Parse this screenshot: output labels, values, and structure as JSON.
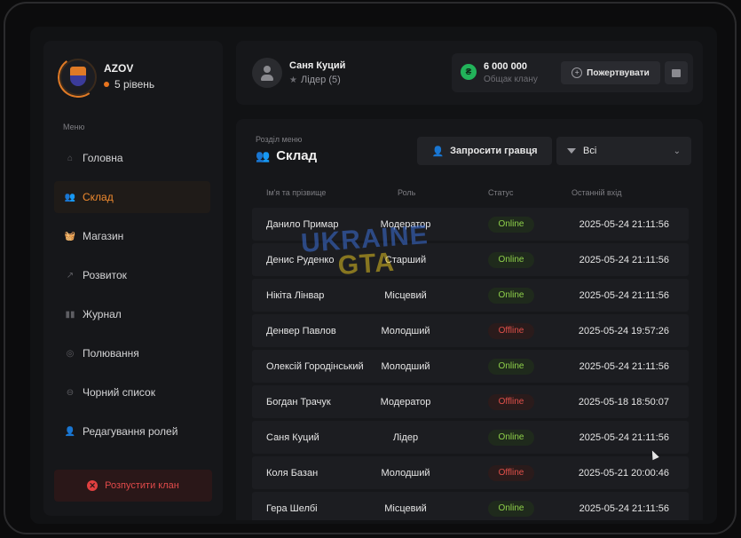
{
  "clan": {
    "name": "AZOV",
    "level": "5 рівень"
  },
  "sidebar": {
    "caption": "Меню",
    "items": [
      {
        "label": "Головна",
        "icon": "home-icon",
        "active": false
      },
      {
        "label": "Склад",
        "icon": "people-icon",
        "active": true
      },
      {
        "label": "Магазин",
        "icon": "basket-icon",
        "active": false
      },
      {
        "label": "Розвиток",
        "icon": "chart-icon",
        "active": false
      },
      {
        "label": "Журнал",
        "icon": "book-icon",
        "active": false
      },
      {
        "label": "Полювання",
        "icon": "target-icon",
        "active": false
      },
      {
        "label": "Чорний список",
        "icon": "block-icon",
        "active": false
      },
      {
        "label": "Редагування ролей",
        "icon": "user-edit-icon",
        "active": false
      }
    ],
    "disband_label": "Розпустити клан"
  },
  "user": {
    "name": "Саня Куций",
    "role": "Лідер (5)"
  },
  "treasury": {
    "amount": "6 000 000",
    "label": "Общак клану",
    "coin": "₴",
    "donate_label": "Пожертвувати"
  },
  "section": {
    "caption": "Розділ меню",
    "title": "Склад",
    "invite_label": "Запросити гравця",
    "filter_value": "Всі"
  },
  "table": {
    "headers": [
      "Ім'я та прізвище",
      "Роль",
      "Статус",
      "Останній вхід"
    ],
    "rows": [
      {
        "name": "Данило Примар",
        "role": "Модератор",
        "status": "Online",
        "last": "2025-05-24 21:11:56"
      },
      {
        "name": "Денис Руденко",
        "role": "Старший",
        "status": "Online",
        "last": "2025-05-24 21:11:56"
      },
      {
        "name": "Нікіта Лінвар",
        "role": "Місцевий",
        "status": "Online",
        "last": "2025-05-24 21:11:56"
      },
      {
        "name": "Денвер Павлов",
        "role": "Молодший",
        "status": "Offline",
        "last": "2025-05-24 19:57:26"
      },
      {
        "name": "Олексій Городінський",
        "role": "Молодший",
        "status": "Online",
        "last": "2025-05-24 21:11:56"
      },
      {
        "name": "Богдан Трачук",
        "role": "Модератор",
        "status": "Offline",
        "last": "2025-05-18 18:50:07"
      },
      {
        "name": "Саня Куций",
        "role": "Лідер",
        "status": "Online",
        "last": "2025-05-24 21:11:56"
      },
      {
        "name": "Коля Базан",
        "role": "Молодший",
        "status": "Offline",
        "last": "2025-05-21 20:00:46"
      },
      {
        "name": "Гера Шелбі",
        "role": "Місцевий",
        "status": "Online",
        "last": "2025-05-24 21:11:56"
      }
    ]
  },
  "watermark": {
    "line1": "UKRAINE",
    "line2": "GTA"
  },
  "colors": {
    "accent": "#f08a2e",
    "online": "#8fd14a",
    "offline": "#e0504a",
    "coin": "#22b35a"
  }
}
